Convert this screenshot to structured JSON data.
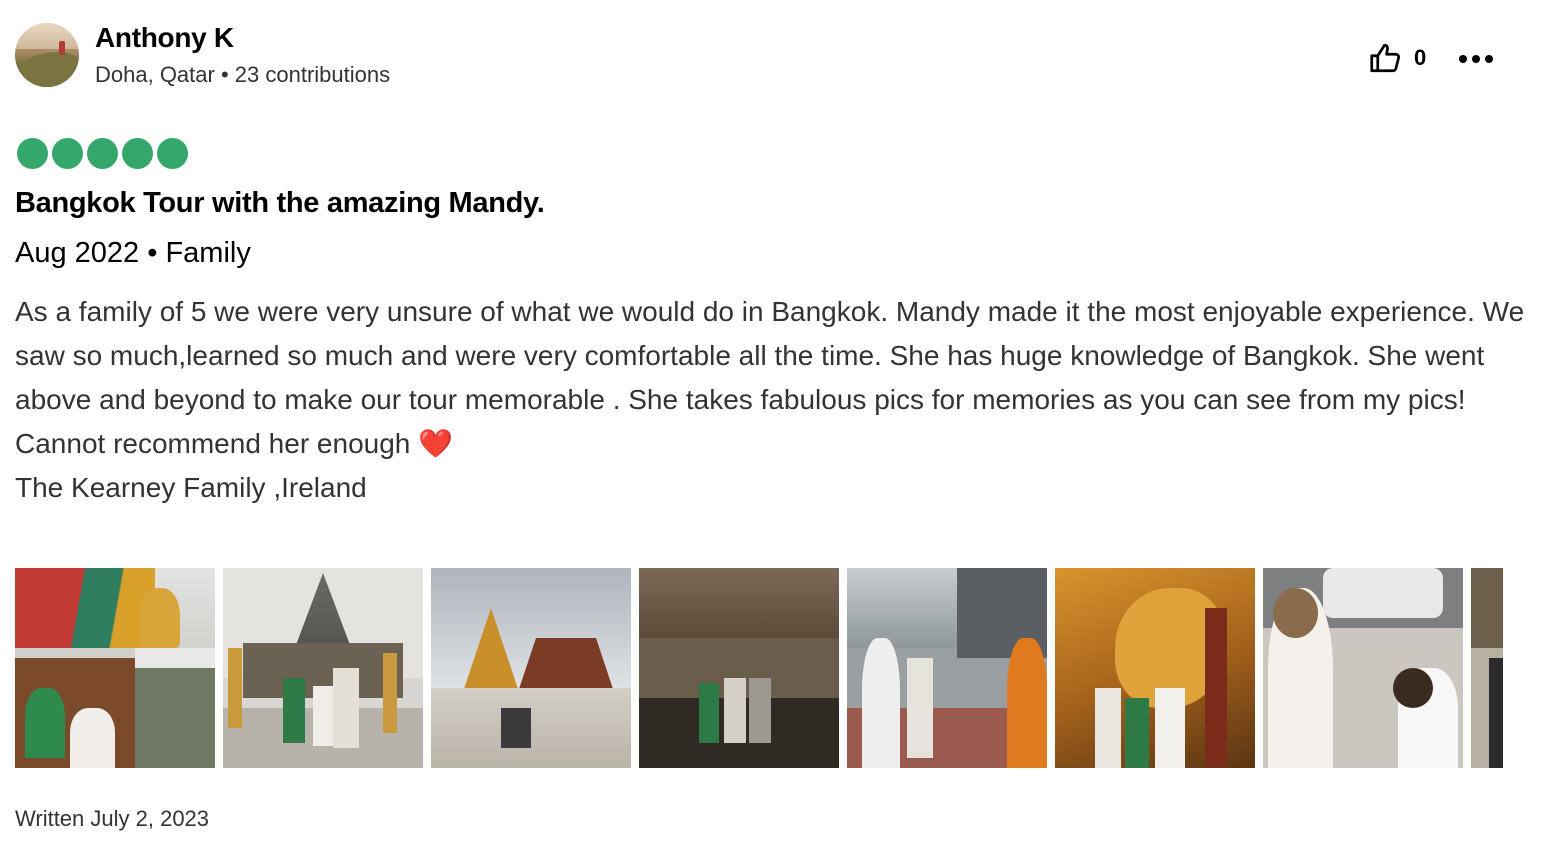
{
  "reviewer": {
    "name": "Anthony K",
    "location": "Doha, Qatar",
    "separator": "•",
    "contributions": "23 contributions",
    "avatar_icon": "avatar-photo"
  },
  "actions": {
    "helpful_icon": "thumbs-up-icon",
    "helpful_count": "0",
    "more_icon": "more-dots-icon"
  },
  "review": {
    "rating": 5,
    "rating_max": 5,
    "rating_color": "#34a86b",
    "title": "Bangkok Tour with the amazing Mandy.",
    "trip_date": "Aug 2022",
    "trip_separator": "•",
    "trip_type": "Family",
    "paragraph": "As a family of 5 we were very unsure of what we would do in Bangkok. Mandy made it the most enjoyable experience. We saw so much,learned so much and were very comfortable all the time. She has huge knowledge of Bangkok. She went above and beyond to make our tour memorable . She takes fabulous pics for memories as you can see from my pics!",
    "line2": "Cannot recommend her enough",
    "heart": "❤️",
    "line3": "The Kearney Family ,Ireland"
  },
  "photos": [
    {
      "label": "long-tail boat and golden Buddha"
    },
    {
      "label": "family at Wat Arun"
    },
    {
      "label": "golden chedi at Grand Palace"
    },
    {
      "label": "family at market hall"
    },
    {
      "label": "family with monk on street"
    },
    {
      "label": "family at reclining Buddha"
    },
    {
      "label": "girl drawing on pavement"
    },
    {
      "label": "partial photo"
    }
  ],
  "footer": {
    "written": "Written July 2, 2023"
  }
}
